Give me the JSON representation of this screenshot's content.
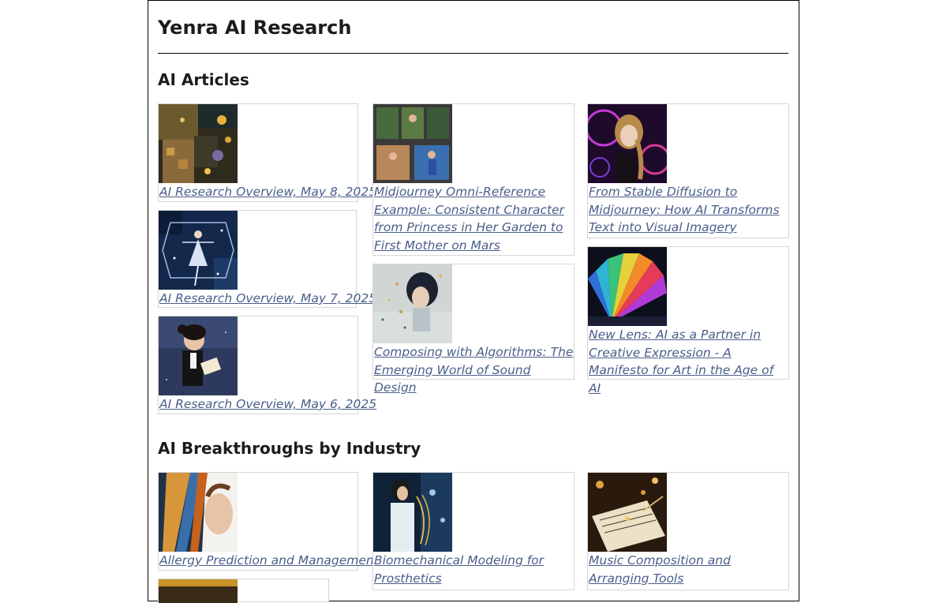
{
  "site": {
    "title": "Yenra AI Research"
  },
  "sections": {
    "articles": {
      "title": "AI Articles",
      "items": [
        {
          "title": "AI Research Overview, May 8, 2025",
          "image": "collage-abstract-thumbnail"
        },
        {
          "title": "Midjourney Omni-Reference Example: Consistent Character from Princess in Her Garden to First Mother on Mars",
          "image": "princess-collage-thumbnail"
        },
        {
          "title": "From Stable Diffusion to Midjourney: How AI Transforms Text into Visual Imagery",
          "image": "neon-girl-thumbnail"
        },
        {
          "title": "AI Research Overview, May 7, 2025",
          "image": "dancer-thumbnail"
        },
        {
          "title": "Composing with Algorithms: The Emerging World of Sound Design",
          "image": "sound-woman-thumbnail"
        },
        {
          "title": "New Lens: AI as a Partner in Creative Expression - A Manifesto for Art in the Age of AI",
          "image": "color-fan-thumbnail"
        },
        {
          "title": "AI Research Overview, May 6, 2025",
          "image": "reading-woman-thumbnail"
        }
      ]
    },
    "industry": {
      "title": "AI Breakthroughs by Industry",
      "items": [
        {
          "title": "Allergy Prediction and Management",
          "image": "woman-profile-thumbnail"
        },
        {
          "title": "Biomechanical Modeling for Prosthetics",
          "image": "lab-woman-thumbnail"
        },
        {
          "title": "Music Composition and Arranging Tools",
          "image": "sheet-music-thumbnail"
        }
      ]
    }
  }
}
